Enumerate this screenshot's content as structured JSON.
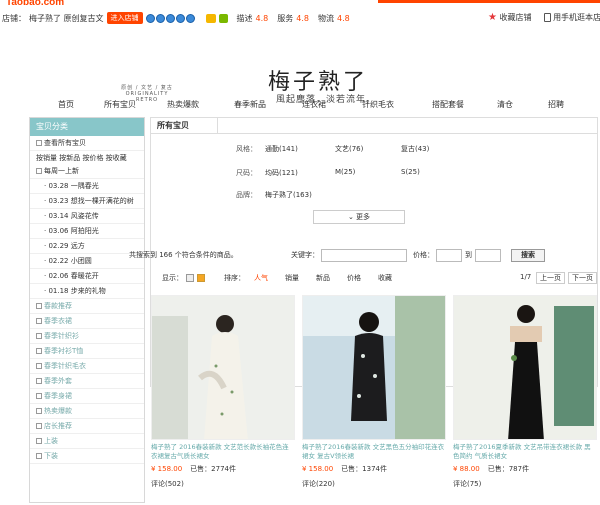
{
  "top": {
    "logo": "Taobao.com",
    "shop_label": "店铺：",
    "shop_name": "梅子熟了 原创复古文",
    "enter_btn": "进入店铺",
    "desc_label": "描述",
    "desc_score": "4.8",
    "service_label": "服务",
    "service_score": "4.8",
    "logistics_label": "物流",
    "logistics_score": "4.8",
    "favorite": "收藏店铺",
    "phone": "用手机逛本店"
  },
  "banner": {
    "en_tag": "原创 / 文艺 / 复古",
    "en_tag2": "ORIGINALITY  RETRO",
    "title": "梅子熟了",
    "subtitle": "風起塵落，淡若流年。"
  },
  "nav": [
    "首页",
    "所有宝贝",
    "热卖爆款",
    "春季新品",
    "连衣裙",
    "针织毛衣",
    "搭配套餐",
    "清仓",
    "招聘"
  ],
  "sidebar": {
    "title": "宝贝分类",
    "view_all": "查看所有宝贝",
    "sort_row": "按销量 按新品 按价格 按收藏",
    "new_weekly": "每周一上新",
    "weekly_items": [
      "03.28 一隅春光",
      "03.23 想找一棵开满花的树",
      "03.14 风姿花传",
      "03.06 阿拍阳光",
      "02.29 远方",
      "02.22 小团圆",
      "02.06 春暖花开",
      "01.18 步来的礼物"
    ],
    "categories": [
      "春款推荐",
      "春季衣裙",
      "春季针织衫",
      "春季衬衫T恤",
      "春季针织毛衣",
      "春季外套",
      "春季身裙",
      "热卖爆款",
      "店长推荐",
      "上装",
      "下装"
    ]
  },
  "main": {
    "heading": "所有宝贝",
    "filters": [
      {
        "label": "风格：",
        "options": [
          "通勤(141)",
          "文艺(76)",
          "复古(43)"
        ]
      },
      {
        "label": "尺码：",
        "options": [
          "均码(121)",
          "M(25)",
          "S(25)"
        ]
      },
      {
        "label": "品牌：",
        "options": [
          "梅子熟了(163)"
        ]
      }
    ],
    "more": "更多",
    "result_text": "共搜索到 166 个符合条件的商品。",
    "keyword_label": "关键字：",
    "price_label": "价格：",
    "to_label": "到",
    "search_btn": "搜索"
  },
  "sortbar": {
    "display_label": "显示：",
    "sort_label": "排序：",
    "sorts": [
      "人气",
      "销量",
      "新品",
      "价格",
      "收藏"
    ],
    "page": "1/7",
    "prev": "上一页",
    "next": "下一页"
  },
  "products": [
    {
      "title": "梅子熟了 2016春装新款 文艺范长款长袖花色连衣裙复古气质长裙女",
      "price": "¥ 158.00",
      "sold": "已售：2774件",
      "comments": "评论(502)"
    },
    {
      "title": "梅子熟了2016春装新款 文艺黑色五分袖印花连衣裙女 复古V领长裙",
      "price": "¥ 158.00",
      "sold": "已售：1374件",
      "comments": "评论(220)"
    },
    {
      "title": "梅子熟了2016夏季新款 文艺吊带连衣裙长款 黑色简约 气质长裙女",
      "price": "¥ 88.00",
      "sold": "已售：787件",
      "comments": "评论(75)"
    }
  ],
  "colors": {
    "accent": "#ff4400",
    "sidebar_head": "#88c6c9",
    "link": "#66aaaa"
  }
}
